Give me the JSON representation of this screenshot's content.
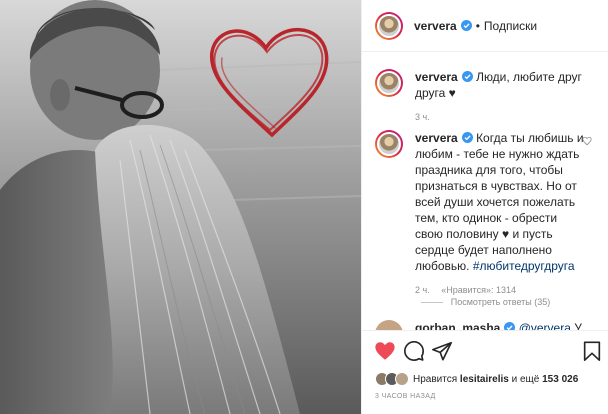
{
  "post": {
    "header": {
      "username": "ververa",
      "separator": "•",
      "follow_label": "Подписки"
    },
    "caption": {
      "username": "ververa",
      "text": "Люди, любите друг друга ♥",
      "time": "3 ч."
    },
    "comment": {
      "username": "ververa",
      "text": "Когда ты любишь и любим - тебе не нужно ждать праздника для того, чтобы признаться в чувствах. Но от всей души хочется пожелать тем, кто одинок - обрести свою половину ♥ и пусть сердце будет наполнено любовью.",
      "hashtag": "#любитедругдруга",
      "time": "2 ч.",
      "likes": "«Нравится»: 1314",
      "replies": "Посмотреть ответы (35)"
    },
    "comment2": {
      "username": "gorban_masha",
      "mention": "@ververa",
      "text": "У"
    },
    "likes_summary": {
      "prefix": "Нравится",
      "user": "lesitairelis",
      "middle": "и ещё",
      "count": "153 026"
    },
    "timestamp": "3 ЧАСОВ НАЗАД",
    "icons": {
      "like": "heart-filled-icon",
      "comment": "comment-icon",
      "share": "share-icon",
      "save": "bookmark-icon",
      "verified": "verified-badge-icon"
    },
    "colors": {
      "like_red": "#ed4956",
      "verified_blue": "#3897f0",
      "heart_sketch": "#b8262b",
      "link_blue": "#00376b"
    }
  }
}
